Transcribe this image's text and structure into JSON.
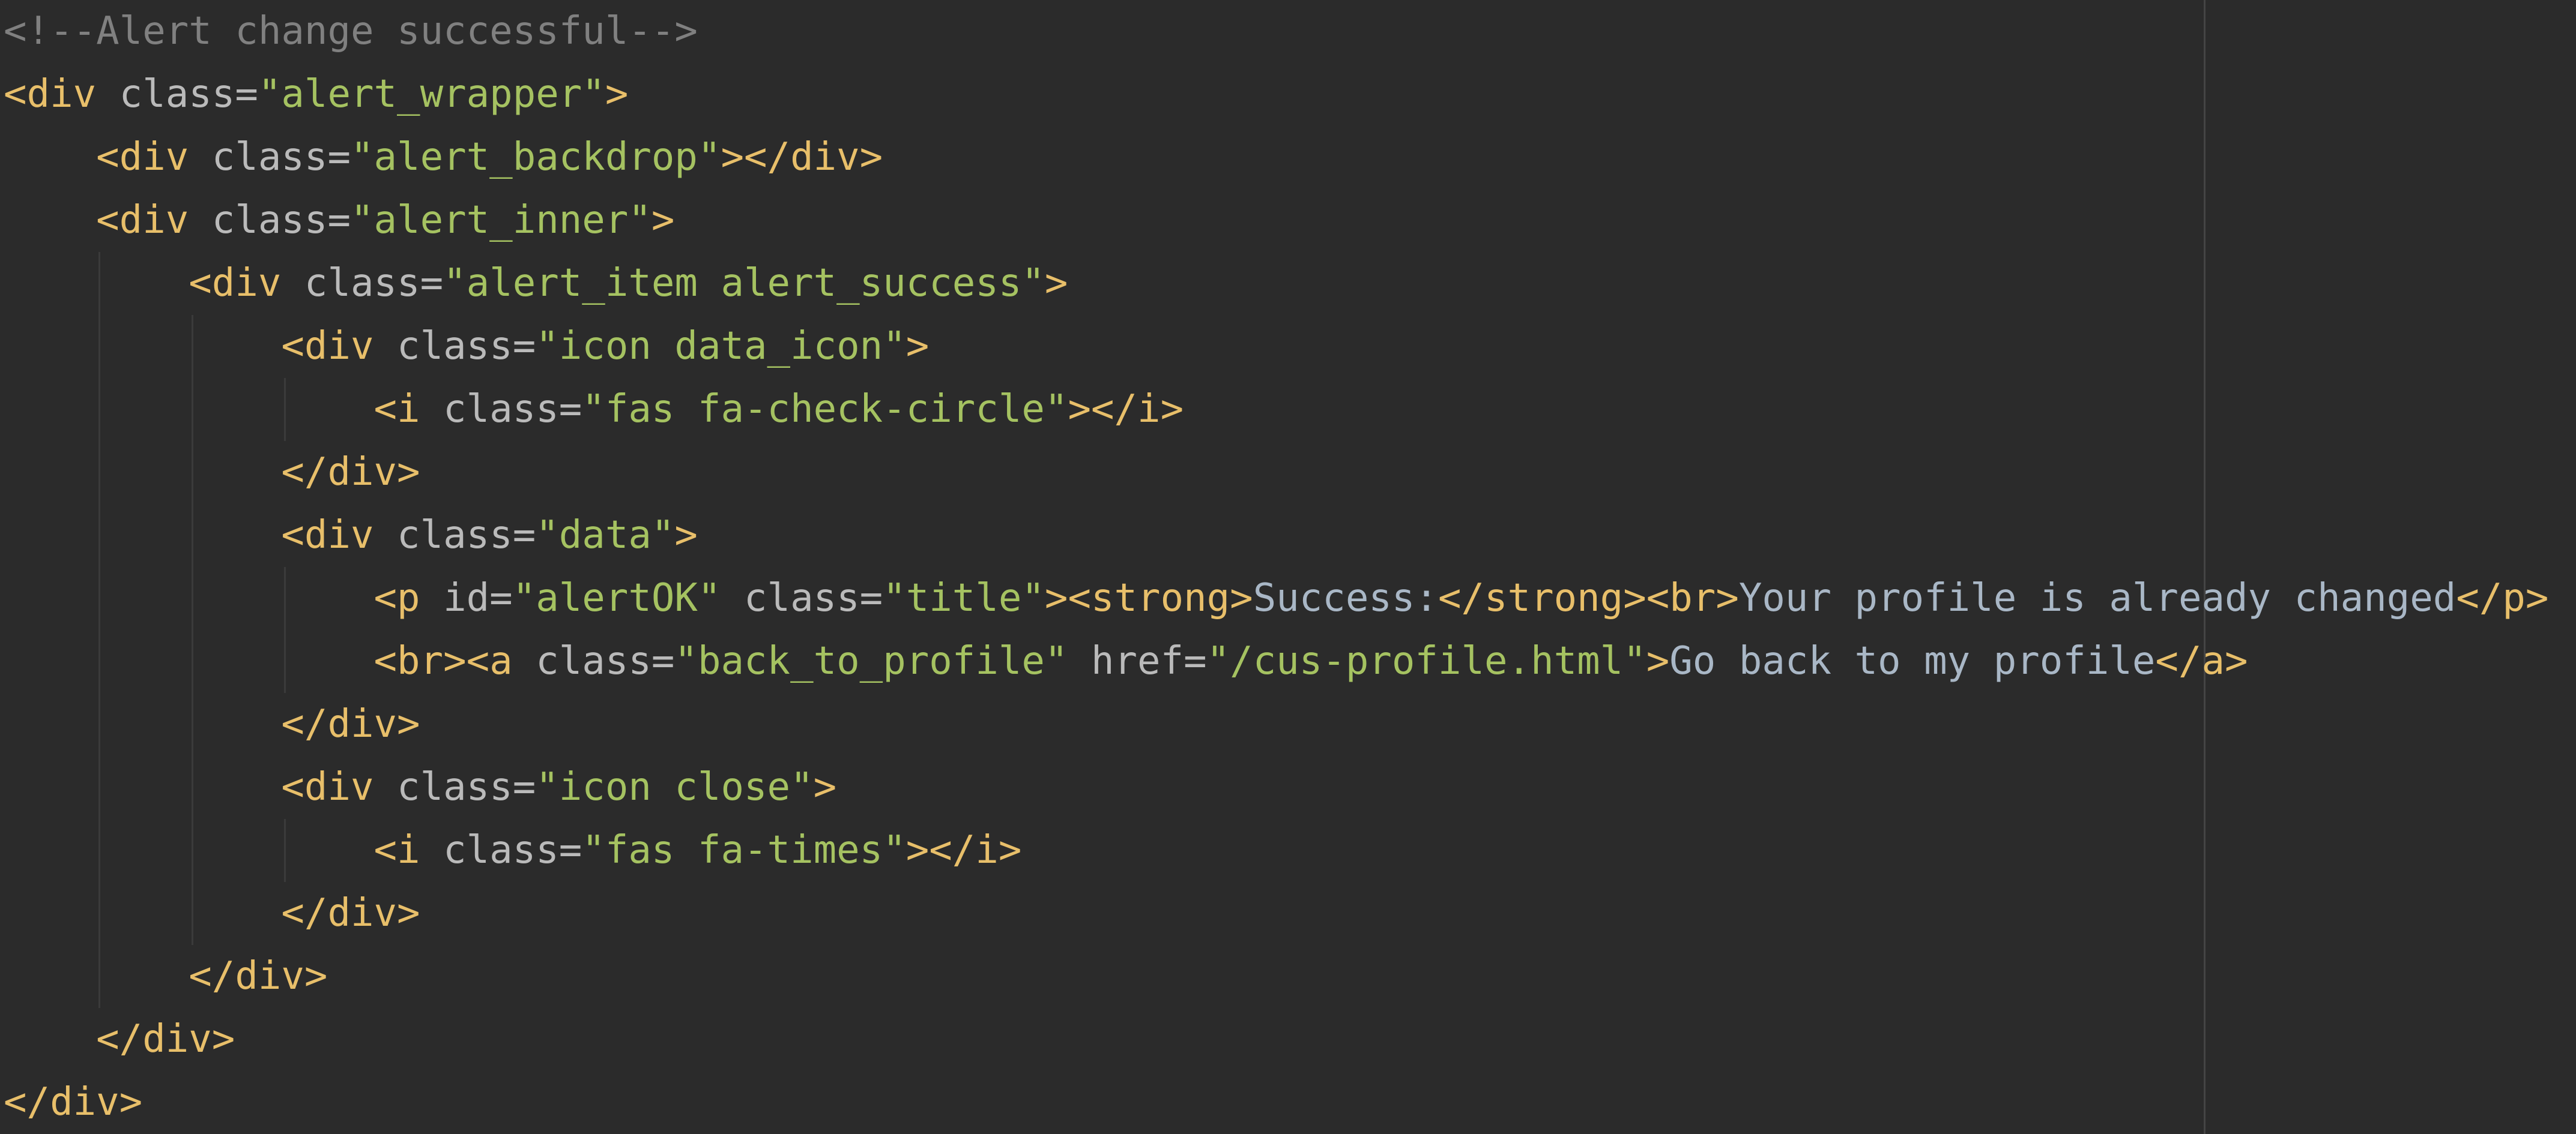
{
  "editor": {
    "lines": [
      {
        "indent": "",
        "guides": [],
        "tokens": [
          {
            "t": "<!--Alert change successful-->",
            "c": "comment"
          }
        ]
      },
      {
        "indent": "",
        "guides": [],
        "tokens": [
          {
            "t": "<div",
            "c": "tag hl"
          },
          {
            "t": " ",
            "c": "text"
          },
          {
            "t": "class",
            "c": "attr"
          },
          {
            "t": "=",
            "c": "attr"
          },
          {
            "t": "\"alert_wrapper\"",
            "c": "val"
          },
          {
            "t": ">",
            "c": "tag"
          }
        ]
      },
      {
        "indent": "    ",
        "guides": [],
        "tokens": [
          {
            "t": "<div",
            "c": "tag"
          },
          {
            "t": " ",
            "c": "text"
          },
          {
            "t": "class",
            "c": "attr"
          },
          {
            "t": "=",
            "c": "attr"
          },
          {
            "t": "\"alert_backdrop\"",
            "c": "val"
          },
          {
            "t": "></div>",
            "c": "tag"
          }
        ]
      },
      {
        "indent": "    ",
        "guides": [],
        "tokens": [
          {
            "t": "<div",
            "c": "tag"
          },
          {
            "t": " ",
            "c": "text"
          },
          {
            "t": "class",
            "c": "attr"
          },
          {
            "t": "=",
            "c": "attr"
          },
          {
            "t": "\"alert_inner\"",
            "c": "val"
          },
          {
            "t": ">",
            "c": "tag"
          }
        ]
      },
      {
        "indent": "        ",
        "guides": [
          1
        ],
        "tokens": [
          {
            "t": "<div",
            "c": "tag"
          },
          {
            "t": " ",
            "c": "text"
          },
          {
            "t": "class",
            "c": "attr"
          },
          {
            "t": "=",
            "c": "attr"
          },
          {
            "t": "\"alert_item alert_success\"",
            "c": "val"
          },
          {
            "t": ">",
            "c": "tag"
          }
        ]
      },
      {
        "indent": "            ",
        "guides": [
          1,
          2
        ],
        "tokens": [
          {
            "t": "<div",
            "c": "tag"
          },
          {
            "t": " ",
            "c": "text"
          },
          {
            "t": "class",
            "c": "attr"
          },
          {
            "t": "=",
            "c": "attr"
          },
          {
            "t": "\"icon data_icon\"",
            "c": "val"
          },
          {
            "t": ">",
            "c": "tag"
          }
        ]
      },
      {
        "indent": "                ",
        "guides": [
          1,
          2,
          3
        ],
        "tokens": [
          {
            "t": "<i",
            "c": "tag"
          },
          {
            "t": " ",
            "c": "text"
          },
          {
            "t": "class",
            "c": "attr"
          },
          {
            "t": "=",
            "c": "attr"
          },
          {
            "t": "\"fas fa-check-circle\"",
            "c": "val"
          },
          {
            "t": "></i>",
            "c": "tag"
          }
        ]
      },
      {
        "indent": "            ",
        "guides": [
          1,
          2
        ],
        "tokens": [
          {
            "t": "</div>",
            "c": "tag"
          }
        ]
      },
      {
        "indent": "            ",
        "guides": [
          1,
          2
        ],
        "tokens": [
          {
            "t": "<div",
            "c": "tag"
          },
          {
            "t": " ",
            "c": "text"
          },
          {
            "t": "class",
            "c": "attr"
          },
          {
            "t": "=",
            "c": "attr"
          },
          {
            "t": "\"data\"",
            "c": "val"
          },
          {
            "t": ">",
            "c": "tag"
          }
        ]
      },
      {
        "indent": "                ",
        "guides": [
          1,
          2,
          3
        ],
        "tokens": [
          {
            "t": "<p",
            "c": "tag"
          },
          {
            "t": " ",
            "c": "text"
          },
          {
            "t": "id",
            "c": "attr"
          },
          {
            "t": "=",
            "c": "attr"
          },
          {
            "t": "\"alertOK\"",
            "c": "val"
          },
          {
            "t": " ",
            "c": "text"
          },
          {
            "t": "class",
            "c": "attr"
          },
          {
            "t": "=",
            "c": "attr"
          },
          {
            "t": "\"title\"",
            "c": "val"
          },
          {
            "t": "><strong>",
            "c": "tag"
          },
          {
            "t": "Success:",
            "c": "text"
          },
          {
            "t": "</strong><br>",
            "c": "tag"
          },
          {
            "t": "Your profile is already changed",
            "c": "text"
          },
          {
            "t": "</p>",
            "c": "tag"
          }
        ]
      },
      {
        "indent": "                ",
        "guides": [
          1,
          2,
          3
        ],
        "tokens": [
          {
            "t": "<br><a",
            "c": "tag"
          },
          {
            "t": " ",
            "c": "text"
          },
          {
            "t": "class",
            "c": "attr"
          },
          {
            "t": "=",
            "c": "attr"
          },
          {
            "t": "\"back_to_profile\"",
            "c": "val"
          },
          {
            "t": " ",
            "c": "text"
          },
          {
            "t": "href",
            "c": "attr"
          },
          {
            "t": "=",
            "c": "attr"
          },
          {
            "t": "\"",
            "c": "val"
          },
          {
            "t": "/cus-profile.html",
            "c": "val sel"
          },
          {
            "t": "\"",
            "c": "val"
          },
          {
            "t": ">",
            "c": "tag"
          },
          {
            "t": "Go back to my profile",
            "c": "text"
          },
          {
            "t": "</a>",
            "c": "tag"
          }
        ]
      },
      {
        "indent": "            ",
        "guides": [
          1,
          2
        ],
        "tokens": [
          {
            "t": "</div>",
            "c": "tag"
          }
        ]
      },
      {
        "indent": "            ",
        "guides": [
          1,
          2
        ],
        "tokens": [
          {
            "t": "<div",
            "c": "tag"
          },
          {
            "t": " ",
            "c": "text"
          },
          {
            "t": "class",
            "c": "attr"
          },
          {
            "t": "=",
            "c": "attr"
          },
          {
            "t": "\"icon close\"",
            "c": "val"
          },
          {
            "t": ">",
            "c": "tag"
          }
        ]
      },
      {
        "indent": "                ",
        "guides": [
          1,
          2,
          3
        ],
        "tokens": [
          {
            "t": "<i",
            "c": "tag"
          },
          {
            "t": " ",
            "c": "text"
          },
          {
            "t": "class",
            "c": "attr"
          },
          {
            "t": "=",
            "c": "attr"
          },
          {
            "t": "\"fas fa-times\"",
            "c": "val"
          },
          {
            "t": "></i>",
            "c": "tag"
          }
        ]
      },
      {
        "indent": "            ",
        "guides": [
          1,
          2
        ],
        "tokens": [
          {
            "t": "</div>",
            "c": "tag"
          }
        ]
      },
      {
        "indent": "        ",
        "guides": [
          1
        ],
        "tokens": [
          {
            "t": "</div>",
            "c": "tag"
          }
        ]
      },
      {
        "indent": "    ",
        "guides": [],
        "tokens": [
          {
            "t": "</div>",
            "c": "tag"
          }
        ]
      },
      {
        "indent": "",
        "guides": [],
        "tokens": [
          {
            "t": "</div>",
            "c": "tag hl"
          }
        ]
      }
    ]
  },
  "colors": {
    "background": "#2b2b2b",
    "comment": "#808080",
    "tag": "#e8bf6a",
    "attr": "#bababa",
    "value": "#a5c261",
    "text": "#a9b7c6",
    "tag_highlight": "#4a2a2a",
    "selection": "#4a4a32"
  }
}
